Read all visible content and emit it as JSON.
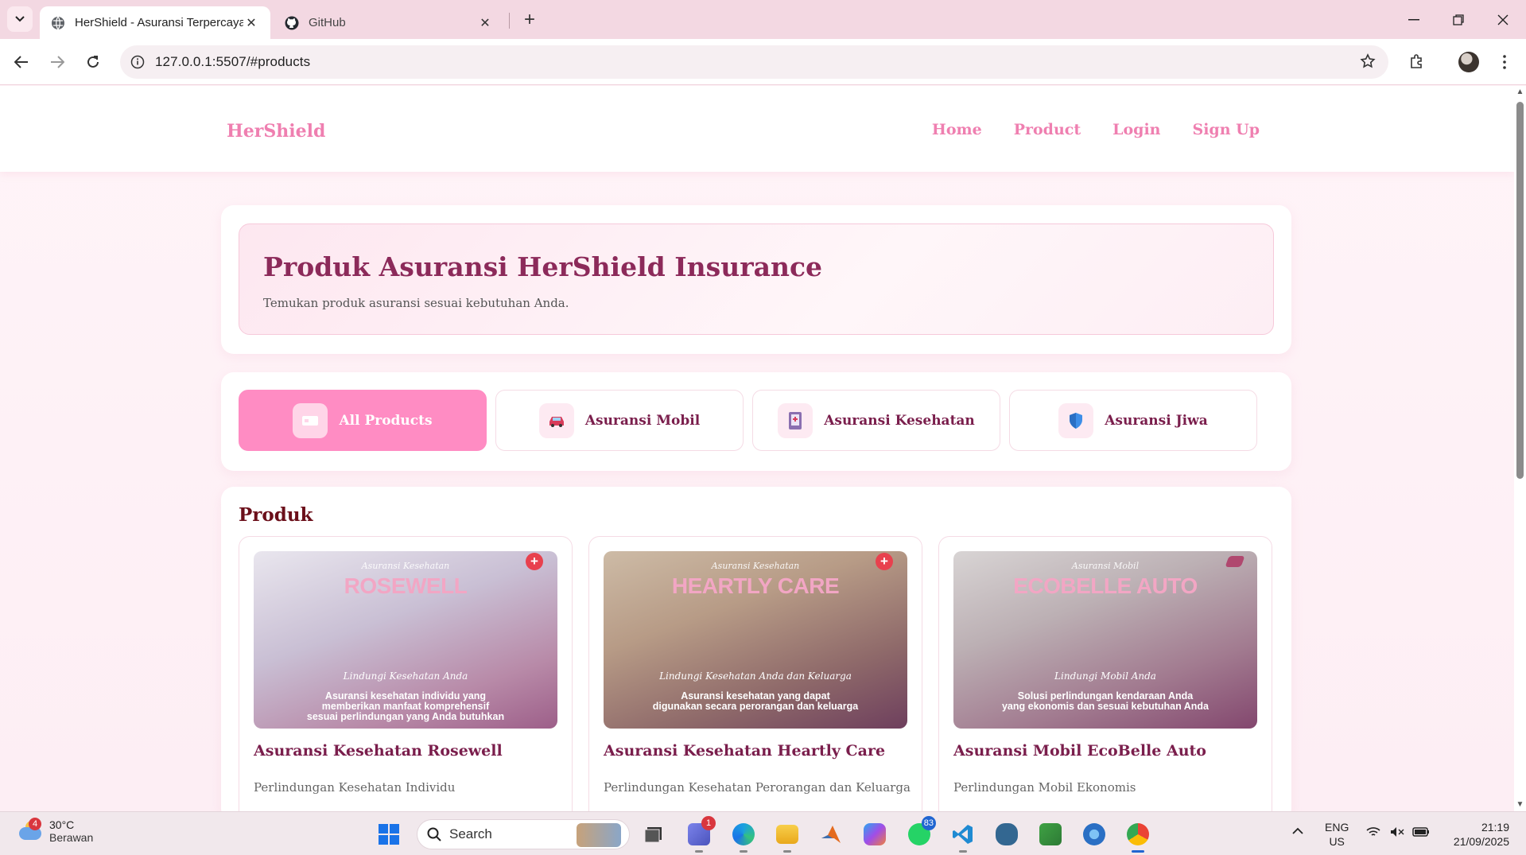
{
  "browser": {
    "tabs": [
      {
        "title": "HerShield - Asuransi Terpercaya",
        "icon": "globe-icon",
        "active": true
      },
      {
        "title": "GitHub",
        "icon": "github-icon",
        "active": false
      }
    ],
    "url": "127.0.0.1:5507/#products"
  },
  "site": {
    "brand": "HerShield",
    "nav": [
      "Home",
      "Product",
      "Login",
      "Sign Up"
    ],
    "hero": {
      "title": "Produk Asuransi HerShield Insurance",
      "subtitle": "Temukan produk asuransi sesuai kebutuhan Anda."
    },
    "filters": [
      {
        "label": "All Products",
        "icon": "ticket-icon",
        "active": true
      },
      {
        "label": "Asuransi Mobil",
        "icon": "car-icon",
        "active": false
      },
      {
        "label": "Asuransi Kesehatan",
        "icon": "medical-book-icon",
        "active": false
      },
      {
        "label": "Asuransi Jiwa",
        "icon": "shield-icon",
        "active": false
      }
    ],
    "section_title": "Produk",
    "products": [
      {
        "name": "Asuransi Kesehatan Rosewell",
        "subtitle": "Perlindungan Kesehatan Individu",
        "image": {
          "tagline": "Asuransi Kesehatan",
          "headline": "ROSEWELL",
          "signature": "Lindungi Kesehatan Anda",
          "description": "Asuransi kesehatan individu yang\nmemberikan manfaat komprehensif\nsesuai perlindungan yang Anda butuhkan"
        }
      },
      {
        "name": "Asuransi Kesehatan Heartly Care",
        "subtitle": "Perlindungan Kesehatan Perorangan dan Keluarga",
        "image": {
          "tagline": "Asuransi Kesehatan",
          "headline": "HEARTLY CARE",
          "signature": "Lindungi Kesehatan Anda dan Keluarga",
          "description": "Asuransi kesehatan yang dapat\ndigunakan secara perorangan dan keluarga"
        }
      },
      {
        "name": "Asuransi Mobil EcoBelle Auto",
        "subtitle": "Perlindungan Mobil Ekonomis",
        "image": {
          "tagline": "Asuransi Mobil",
          "headline": "ECOBELLE AUTO",
          "signature": "Lindungi Mobil Anda",
          "description": "Solusi perlindungan kendaraan Anda\nyang ekonomis dan sesuai kebutuhan Anda"
        }
      }
    ]
  },
  "taskbar": {
    "weather": {
      "temp": "30°C",
      "condition": "Berawan",
      "badge": "4"
    },
    "search_placeholder": "Search",
    "teams_badge": "1",
    "whatsapp_badge": "83",
    "language": {
      "line1": "ENG",
      "line2": "US"
    },
    "time": "21:19",
    "date": "21/09/2025"
  },
  "colors": {
    "brand_pink": "#ef7fb0",
    "active_filter": "#ff8cc3",
    "heading_maroon": "#8c2a5a"
  }
}
